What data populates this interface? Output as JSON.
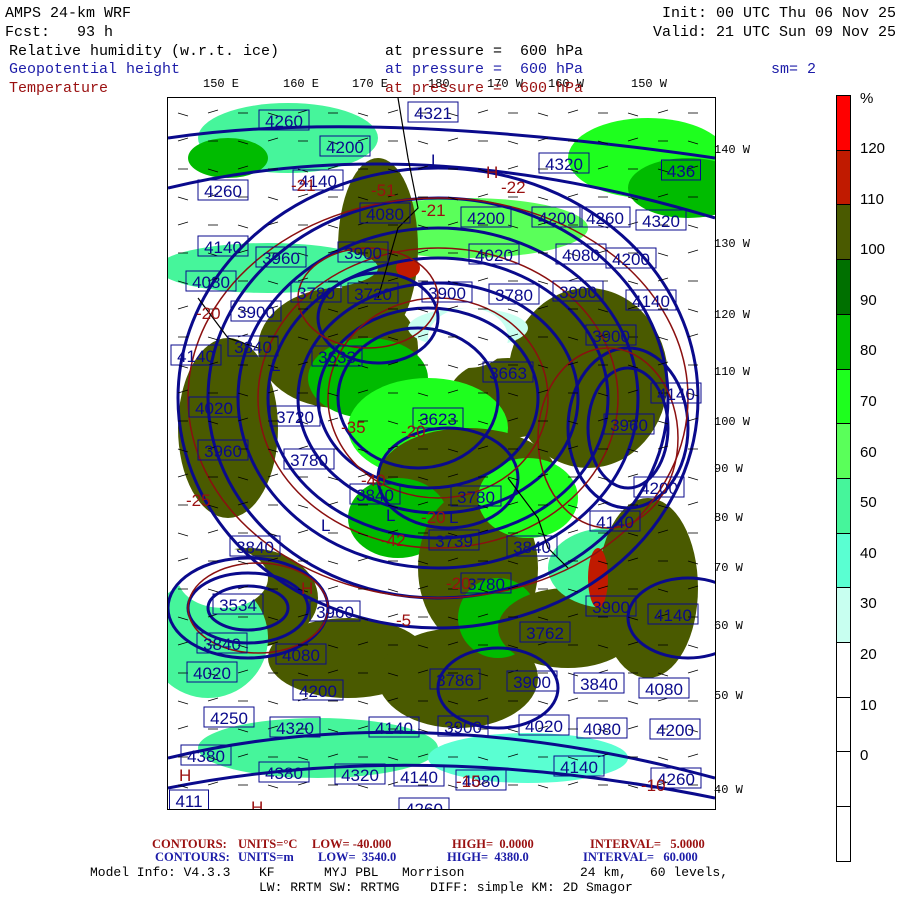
{
  "header": {
    "model": "AMPS 24-km WRF",
    "fcst": "Fcst:   93 h",
    "init": "Init: 00 UTC Thu 06 Nov 25",
    "valid": "Valid: 21 UTC Sun 09 Nov 25",
    "fields": [
      {
        "name": "Relative humidity (w.r.t. ice)",
        "level": "at pressure =  600 hPa"
      },
      {
        "name": "Geopotential height",
        "level": "at pressure =  600 hPa"
      },
      {
        "name": "Temperature",
        "level": "at pressure =  600 hPa"
      }
    ],
    "smoothing": "sm= 2"
  },
  "map": {
    "lon_labels": [
      "150 E",
      "160 E",
      "170 E",
      "180",
      "170 W",
      "160 W",
      "150 W"
    ],
    "lat_labels": [
      "140 W",
      "130 W",
      "120 W",
      "110 W",
      "100 W",
      "90 W",
      "80 W",
      "70 W",
      "60 W",
      "50 W",
      "40 W"
    ],
    "height_labels": [
      "4260",
      "4321",
      "4200",
      "4140",
      "4260",
      "4320",
      "436",
      "4080",
      "4200",
      "4200",
      "4260",
      "4320",
      "4140",
      "3960",
      "3900",
      "4020",
      "4080",
      "4200",
      "4080",
      "3780",
      "3720",
      "3900",
      "3780",
      "3900",
      "4140",
      "3900",
      "3900",
      "3840",
      "4140",
      "3633",
      "3663",
      "4140",
      "4020",
      "3720",
      "3623",
      "3960",
      "3960",
      "3780",
      "3840",
      "3780",
      "4200",
      "3739",
      "3840",
      "4140",
      "3840",
      "3780",
      "3534",
      "3960",
      "3762",
      "3900",
      "4140",
      "3840",
      "4080",
      "4020",
      "3786",
      "3900",
      "3840",
      "4080",
      "4200",
      "4250",
      "4320",
      "4140",
      "3900",
      "4020",
      "4080",
      "4200",
      "4380",
      "4380",
      "4320",
      "4140",
      "4080",
      "4140",
      "4260",
      "4260",
      "411"
    ],
    "temperature_labels": [
      "-21",
      "-51",
      "-22",
      "-21",
      "-20",
      "-35",
      "-20",
      "-40",
      "-42",
      "-20",
      "-20",
      "-15",
      "-10",
      "-5",
      "-25"
    ],
    "pressure_centers": [
      "H",
      "L",
      "L",
      "L",
      "L",
      "H",
      "L",
      "H",
      "H"
    ]
  },
  "colorbar": {
    "unit": "%",
    "ticks": [
      "120",
      "110",
      "100",
      "90",
      "80",
      "70",
      "60",
      "50",
      "40",
      "30",
      "20",
      "10",
      "0"
    ],
    "colors": [
      "#ff0000",
      "#c01a00",
      "#4a5a00",
      "#007000",
      "#00bb00",
      "#1eff1e",
      "#5aff5a",
      "#46f59b",
      "#5affd2",
      "#c8fff0",
      "#ffffff",
      "#ffffff",
      "#ffffff",
      "#ffffff"
    ]
  },
  "footer": {
    "temp_contours": {
      "label": "CONTOURS:",
      "units": "UNITS=°C",
      "low": "LOW= -40.000",
      "high": "HIGH=  0.0000",
      "interval": "INTERVAL=   5.0000"
    },
    "height_contours": {
      "label": "CONTOURS:",
      "units": "UNITS=m",
      "low": "LOW=  3540.0",
      "high": "HIGH=  4380.0",
      "interval": "INTERVAL=   60.000"
    },
    "model_info": "Model Info: V4.3.3",
    "cumulus": "KF",
    "pbl": "MYJ PBL",
    "microphysics": "Morrison",
    "resolution": "24 km,",
    "levels": "60 levels,",
    "radiation": "LW: RRTM SW: RRTMG",
    "diffusion": "DIFF: simple KM: 2D Smagor"
  }
}
